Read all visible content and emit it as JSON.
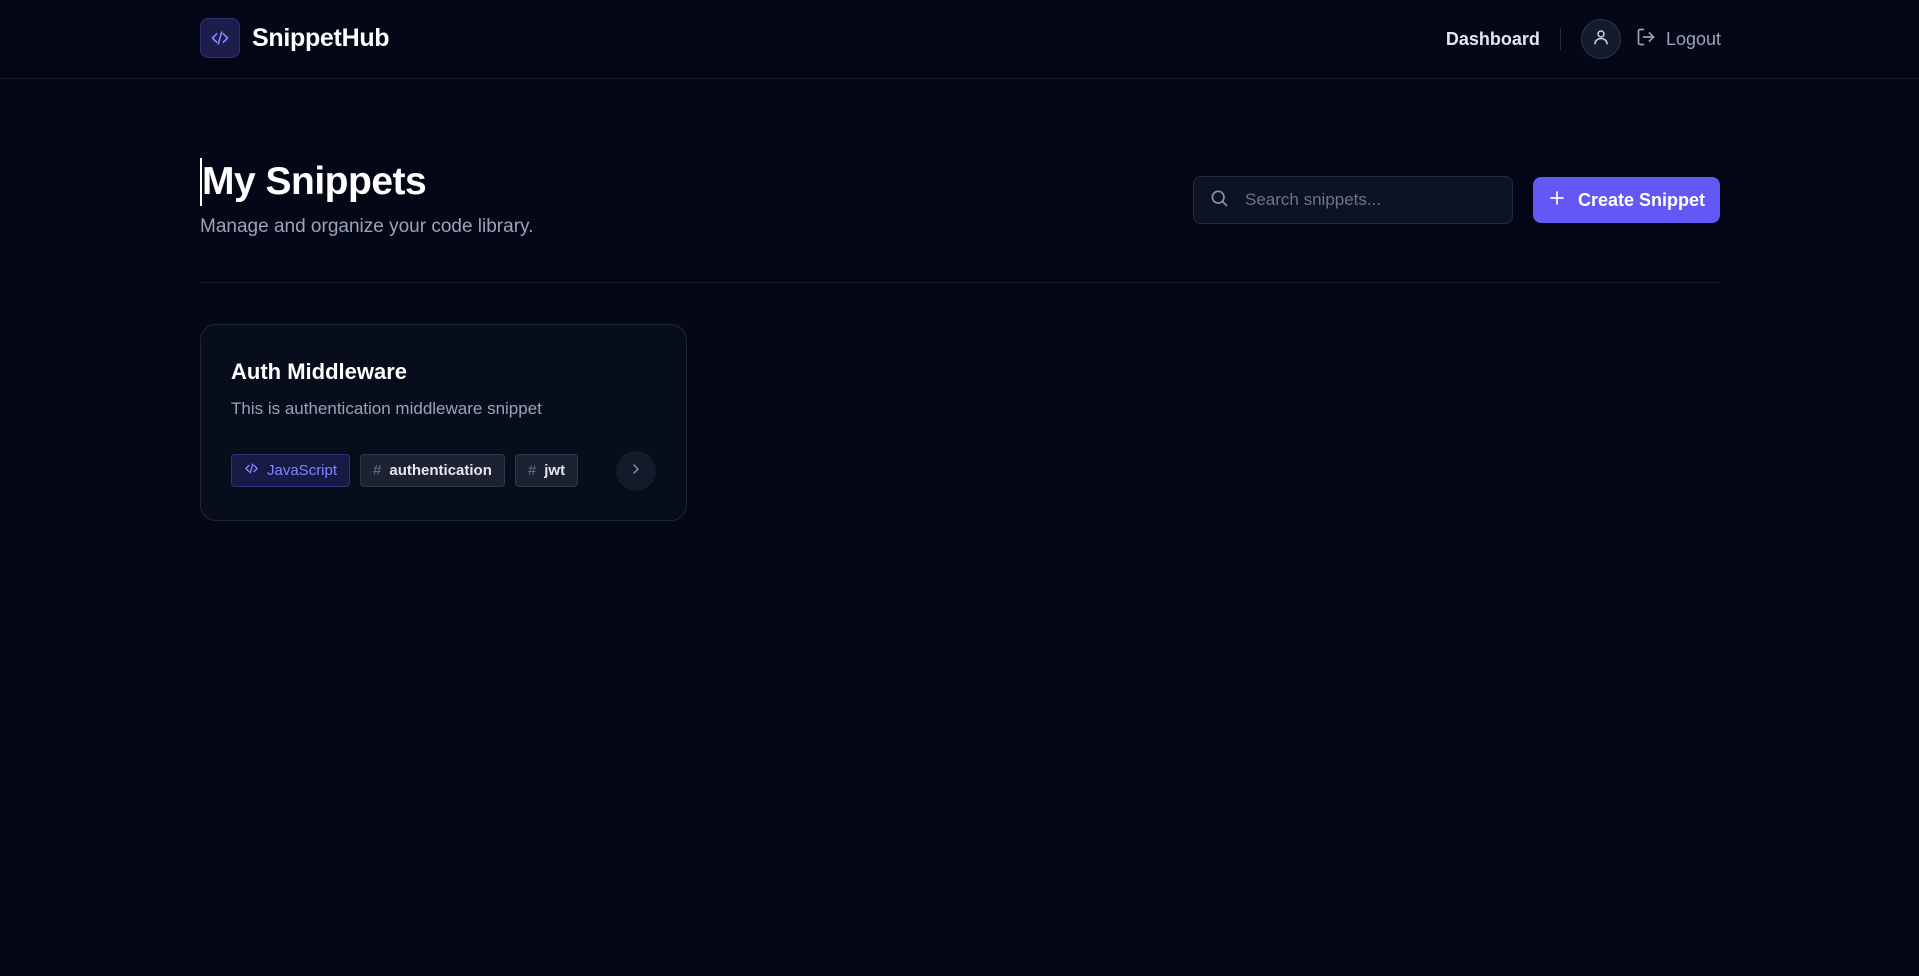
{
  "header": {
    "brand_name": "SnippetHub",
    "nav_dashboard": "Dashboard",
    "logout_label": "Logout"
  },
  "page": {
    "title": "My Snippets",
    "subtitle": "Manage and organize your code library."
  },
  "search": {
    "placeholder": "Search snippets...",
    "value": ""
  },
  "create_button": {
    "label": "Create Snippet"
  },
  "snippets": [
    {
      "title": "Auth Middleware",
      "description": "This is authentication middleware snippet",
      "language": "JavaScript",
      "tags": [
        "authentication",
        "jwt"
      ]
    }
  ],
  "colors": {
    "background": "#040716",
    "accent": "#6358f5",
    "language_tag_text": "#8286ff"
  },
  "icons": {
    "brand": "code-icon",
    "avatar": "user-icon",
    "logout": "logout-icon",
    "search": "search-icon",
    "create": "plus-icon",
    "language": "code-icon",
    "tag": "hash-icon",
    "open": "chevron-right-icon"
  }
}
